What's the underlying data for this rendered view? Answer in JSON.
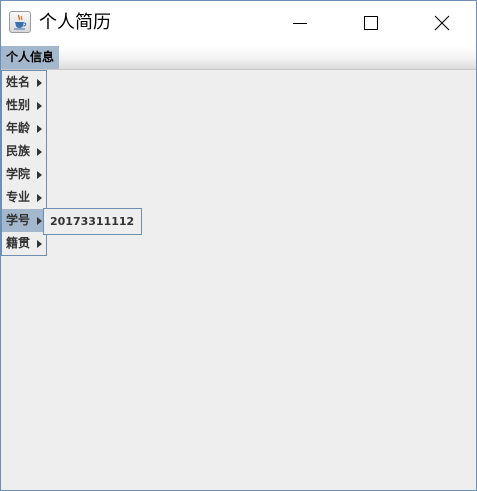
{
  "window": {
    "title": "个人简历",
    "icon": "java-coffee-cup-icon"
  },
  "title_buttons": {
    "minimize": "minimize-icon",
    "maximize": "maximize-icon",
    "close": "close-icon"
  },
  "menubar": {
    "menu_label": "个人信息"
  },
  "popup": {
    "items": [
      {
        "label": "姓名"
      },
      {
        "label": "性别"
      },
      {
        "label": "年龄"
      },
      {
        "label": "民族"
      },
      {
        "label": "学院"
      },
      {
        "label": "专业"
      },
      {
        "label": "学号"
      },
      {
        "label": "籍贯"
      }
    ],
    "active_index": 6
  },
  "submenu": {
    "items": [
      "20173311112"
    ]
  },
  "colors": {
    "selection": "#a3b8cc",
    "border": "#6f8fb0",
    "panel": "#eeeeee"
  }
}
